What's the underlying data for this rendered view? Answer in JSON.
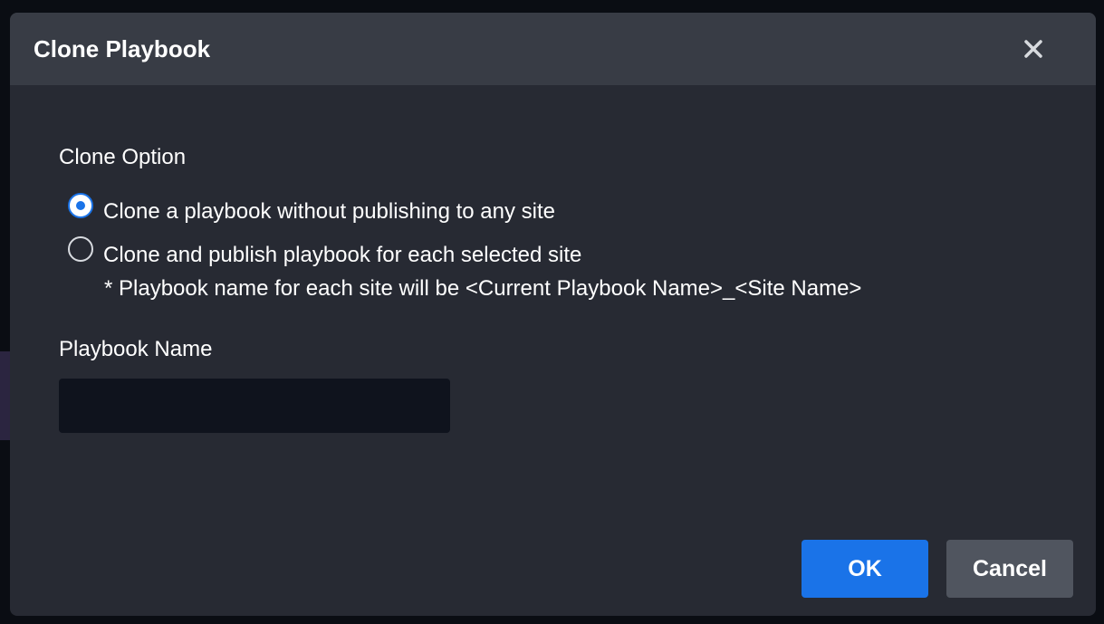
{
  "dialog": {
    "title": "Clone Playbook",
    "close_icon": "close-icon"
  },
  "clone_option": {
    "label": "Clone Option",
    "options": [
      {
        "label": "Clone a playbook without publishing to any site",
        "selected": true
      },
      {
        "label": "Clone and publish playbook for each selected site",
        "selected": false
      }
    ],
    "note": "* Playbook name for each site will be <Current Playbook Name>_<Site Name>"
  },
  "playbook_name": {
    "label": "Playbook Name",
    "value": "",
    "placeholder": ""
  },
  "buttons": {
    "ok_label": "OK",
    "cancel_label": "Cancel"
  },
  "colors": {
    "accent": "#1a73e8",
    "dialog_bg": "#272a33",
    "header_bg": "#383c45",
    "input_bg": "#0f131d",
    "cancel_bg": "#50555f"
  }
}
